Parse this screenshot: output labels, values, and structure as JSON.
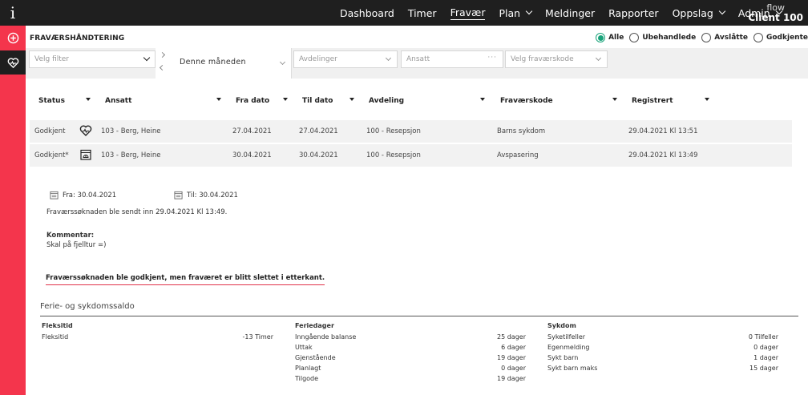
{
  "app": {
    "logo": "i",
    "client_line1": "flow",
    "client_line2": "Client 100"
  },
  "nav": [
    {
      "label": "Dashboard",
      "active": false,
      "dropdown": false
    },
    {
      "label": "Timer",
      "active": false,
      "dropdown": false
    },
    {
      "label": "Fravær",
      "active": true,
      "dropdown": false
    },
    {
      "label": "Plan",
      "active": false,
      "dropdown": true
    },
    {
      "label": "Meldinger",
      "active": false,
      "dropdown": false
    },
    {
      "label": "Rapporter",
      "active": false,
      "dropdown": false
    },
    {
      "label": "Oppslag",
      "active": false,
      "dropdown": true
    },
    {
      "label": "Admin",
      "active": false,
      "dropdown": true
    }
  ],
  "sidebar": {
    "icons": [
      "plus-circle-icon",
      "heart-pulse-icon"
    ]
  },
  "page": {
    "title": "FRAVÆRSHÅNDTERING"
  },
  "status_filter": {
    "options": [
      "Alle",
      "Ubehandlede",
      "Avslåtte",
      "Godkjente"
    ],
    "selected": "Alle",
    "selected_color": "#19a37a"
  },
  "filters": {
    "filter_placeholder": "Velg filter",
    "period": "Denne måneden",
    "department_placeholder": "Avdelinger",
    "employee_placeholder": "Ansatt",
    "absence_code_placeholder": "Velg fraværskode"
  },
  "table": {
    "columns": [
      "Status",
      "Ansatt",
      "Fra dato",
      "Til dato",
      "Avdeling",
      "Fraværskode",
      "Registrert"
    ],
    "rows": [
      {
        "status": "Godkjent",
        "icon": "heart-pulse-icon",
        "employee": "103 - Berg, Heine",
        "from": "27.04.2021",
        "to": "27.04.2021",
        "department": "100 - Resepsjon",
        "code": "Barns sykdom",
        "registered": "29.04.2021 Kl 13:51"
      },
      {
        "status": "Godkjent*",
        "icon": "calendar-vacation-icon",
        "employee": "103 - Berg, Heine",
        "from": "30.04.2021",
        "to": "30.04.2021",
        "department": "100 - Resepsjon",
        "code": "Avspasering",
        "registered": "29.04.2021 Kl 13:49"
      }
    ]
  },
  "detail": {
    "from": "Fra: 30.04.2021",
    "to": "Til: 30.04.2021",
    "sent_text": "Fraværssøknaden ble sendt inn 29.04.2021 Kl 13:49.",
    "comment_label": "Kommentar:",
    "comment": "Skal på fjelltur =)",
    "warning": "Fraværssøknaden ble godkjent, men fraværet er blitt slettet i etterkant.",
    "warning_color": "#e0324a"
  },
  "saldo": {
    "title": "Ferie- og sykdomssaldo",
    "fleksitid": {
      "heading": "Fleksitid",
      "rows": [
        {
          "label": "Fleksitid",
          "value": "-13 Timer"
        }
      ]
    },
    "feriedager": {
      "heading": "Feriedager",
      "rows": [
        {
          "label": "Inngående balanse",
          "value": "25 dager"
        },
        {
          "label": "Uttak",
          "value": "6 dager"
        },
        {
          "label": "Gjenstående",
          "value": "19 dager"
        },
        {
          "label": "Planlagt",
          "value": "0 dager"
        },
        {
          "label": "Tilgode",
          "value": "19 dager"
        }
      ]
    },
    "sykdom": {
      "heading": "Sykdom",
      "rows": [
        {
          "label": "Syketilfeller",
          "value": "0 Tilfeller"
        },
        {
          "label": "Egenmelding",
          "value": "0 dager"
        },
        {
          "label": "Sykt barn",
          "value": "1 dager"
        },
        {
          "label": "Sykt barn maks",
          "value": "15 dager"
        }
      ]
    }
  },
  "colors": {
    "topbar": "#1f1f1f",
    "sidebar": "#f4354c",
    "accent_green": "#19a37a"
  }
}
